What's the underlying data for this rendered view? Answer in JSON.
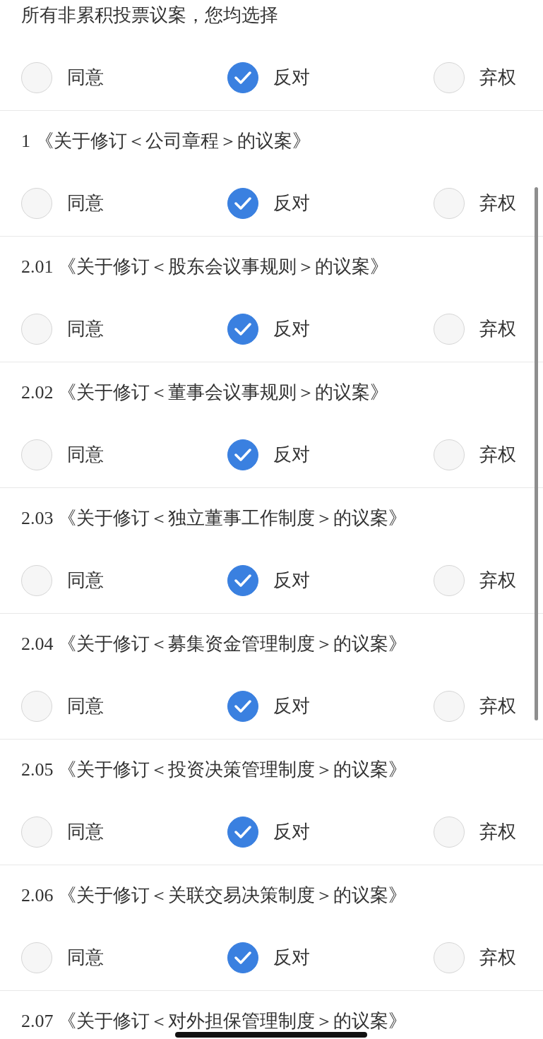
{
  "batch": {
    "title": "所有非累积投票议案，您均选择",
    "options": [
      {
        "label": "同意",
        "selected": false
      },
      {
        "label": "反对",
        "selected": true
      },
      {
        "label": "弃权",
        "selected": false
      }
    ]
  },
  "proposals": [
    {
      "title": "1 《关于修订＜公司章程＞的议案》",
      "options": [
        {
          "label": "同意",
          "selected": false
        },
        {
          "label": "反对",
          "selected": true
        },
        {
          "label": "弃权",
          "selected": false
        }
      ]
    },
    {
      "title": "2.01 《关于修订＜股东会议事规则＞的议案》",
      "options": [
        {
          "label": "同意",
          "selected": false
        },
        {
          "label": "反对",
          "selected": true
        },
        {
          "label": "弃权",
          "selected": false
        }
      ]
    },
    {
      "title": "2.02 《关于修订＜董事会议事规则＞的议案》",
      "options": [
        {
          "label": "同意",
          "selected": false
        },
        {
          "label": "反对",
          "selected": true
        },
        {
          "label": "弃权",
          "selected": false
        }
      ]
    },
    {
      "title": "2.03 《关于修订＜独立董事工作制度＞的议案》",
      "options": [
        {
          "label": "同意",
          "selected": false
        },
        {
          "label": "反对",
          "selected": true
        },
        {
          "label": "弃权",
          "selected": false
        }
      ]
    },
    {
      "title": "2.04 《关于修订＜募集资金管理制度＞的议案》",
      "options": [
        {
          "label": "同意",
          "selected": false
        },
        {
          "label": "反对",
          "selected": true
        },
        {
          "label": "弃权",
          "selected": false
        }
      ]
    },
    {
      "title": "2.05 《关于修订＜投资决策管理制度＞的议案》",
      "options": [
        {
          "label": "同意",
          "selected": false
        },
        {
          "label": "反对",
          "selected": true
        },
        {
          "label": "弃权",
          "selected": false
        }
      ]
    },
    {
      "title": "2.06 《关于修订＜关联交易决策制度＞的议案》",
      "options": [
        {
          "label": "同意",
          "selected": false
        },
        {
          "label": "反对",
          "selected": true
        },
        {
          "label": "弃权",
          "selected": false
        }
      ]
    },
    {
      "title": "2.07 《关于修订＜对外担保管理制度＞的议案》"
    }
  ]
}
